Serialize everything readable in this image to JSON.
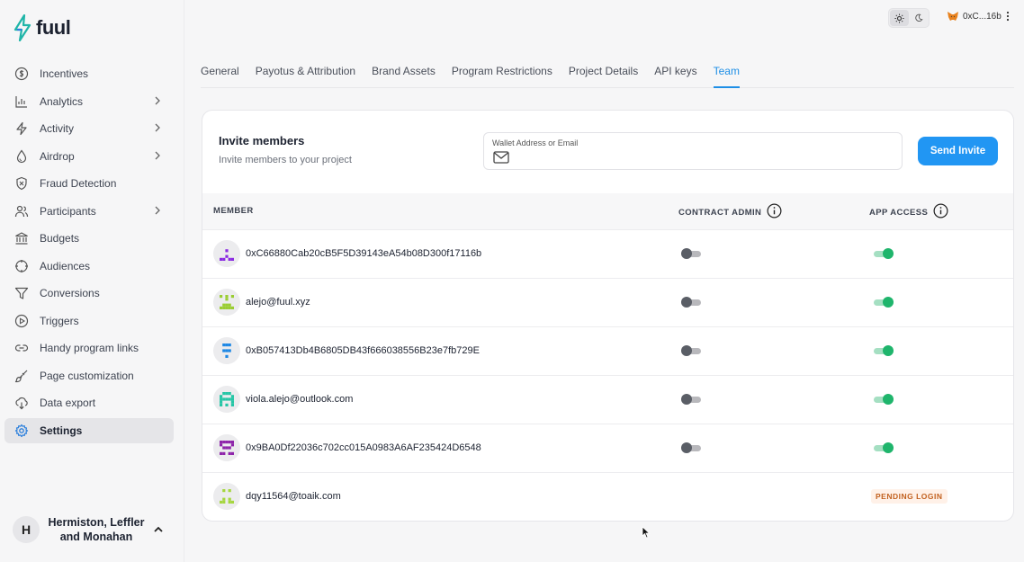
{
  "brand": {
    "name": "fuul",
    "logo_color": "#1fb5a8"
  },
  "sidebar": {
    "items": [
      {
        "label": "Incentives",
        "icon": "dollar-icon",
        "chevron": false
      },
      {
        "label": "Analytics",
        "icon": "bar-chart-icon",
        "chevron": true
      },
      {
        "label": "Activity",
        "icon": "bolt-icon",
        "chevron": true
      },
      {
        "label": "Airdrop",
        "icon": "droplet-icon",
        "chevron": true
      },
      {
        "label": "Fraud Detection",
        "icon": "shield-icon",
        "chevron": false
      },
      {
        "label": "Participants",
        "icon": "users-icon",
        "chevron": true
      },
      {
        "label": "Budgets",
        "icon": "bank-icon",
        "chevron": false
      },
      {
        "label": "Audiences",
        "icon": "target-icon",
        "chevron": false
      },
      {
        "label": "Conversions",
        "icon": "funnel-icon",
        "chevron": false
      },
      {
        "label": "Triggers",
        "icon": "play-icon",
        "chevron": false
      },
      {
        "label": "Handy program links",
        "icon": "link-icon",
        "chevron": false
      },
      {
        "label": "Page customization",
        "icon": "brush-icon",
        "chevron": false
      },
      {
        "label": "Data export",
        "icon": "cloud-download-icon",
        "chevron": false
      },
      {
        "label": "Settings",
        "icon": "gear-icon",
        "chevron": false,
        "active": true
      }
    ],
    "org": {
      "initial": "H",
      "name": "Hermiston, Leffler and Monahan"
    }
  },
  "topbar": {
    "wallet_label": "0xC...16b",
    "theme": "light"
  },
  "tabs": [
    {
      "label": "General"
    },
    {
      "label": "Payotus & Attribution"
    },
    {
      "label": "Brand Assets"
    },
    {
      "label": "Program Restrictions"
    },
    {
      "label": "Project Details"
    },
    {
      "label": "API keys"
    },
    {
      "label": "Team",
      "active": true
    }
  ],
  "invite": {
    "title": "Invite members",
    "subtitle": "Invite members to your project",
    "input_label": "Wallet Address or Email",
    "input_value": "",
    "send_label": "Send Invite"
  },
  "table": {
    "headers": {
      "member": "MEMBER",
      "contract_admin": "CONTRACT ADMIN",
      "app_access": "APP ACCESS"
    },
    "rows": [
      {
        "member": "0xC66880Cab20cB5F5D39143eA54b08D300f17116b",
        "contract_admin": false,
        "app_access": true,
        "avatar_color": "#8a2be2"
      },
      {
        "member": "alejo@fuul.xyz",
        "contract_admin": false,
        "app_access": true,
        "avatar_color": "#9acd32"
      },
      {
        "member": "0xB057413Db4B6805DB43f666038556B23e7fb729E",
        "contract_admin": false,
        "app_access": true,
        "avatar_color": "#1e88e5"
      },
      {
        "member": "viola.alejo@outlook.com",
        "contract_admin": false,
        "app_access": true,
        "avatar_color": "#26c6a6"
      },
      {
        "member": "0x9BA0Df22036c702cc015A0983A6AF235424D6548",
        "contract_admin": false,
        "app_access": true,
        "avatar_color": "#8e24aa"
      },
      {
        "member": "dqy11564@toaik.com",
        "status": "PENDING LOGIN",
        "avatar_color": "#a5d63f"
      }
    ]
  },
  "colors": {
    "accent": "#2196f3",
    "toggle_on": "#1fb56c",
    "pending": "#c2611f"
  }
}
